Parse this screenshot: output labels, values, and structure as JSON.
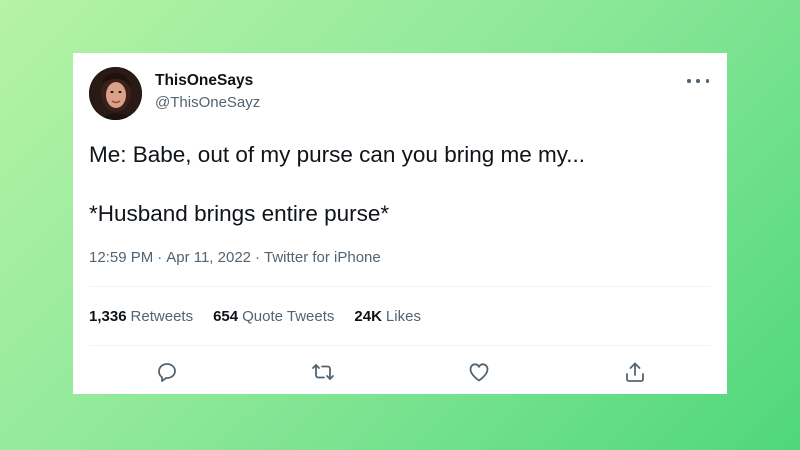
{
  "tweet": {
    "display_name": "ThisOneSays",
    "handle": "@ThisOneSayz",
    "line1": "Me: Babe, out of my purse can you bring me my...",
    "line2": "*Husband brings entire purse*",
    "time": "12:59 PM",
    "separator": "·",
    "date": "Apr 11, 2022",
    "source": "Twitter for iPhone"
  },
  "stats": {
    "retweets_count": "1,336",
    "retweets_label": "Retweets",
    "quotes_count": "654",
    "quotes_label": "Quote Tweets",
    "likes_count": "24K",
    "likes_label": "Likes"
  },
  "icons": {
    "more": "more-horizontal-icon",
    "reply": "reply-icon",
    "retweet": "retweet-icon",
    "like": "heart-icon",
    "share": "share-icon"
  },
  "colors": {
    "text_primary": "#0f1419",
    "text_secondary": "#536471",
    "background_gradient_start": "#b6f3a6",
    "background_gradient_end": "#4fd77c",
    "card": "#ffffff"
  }
}
